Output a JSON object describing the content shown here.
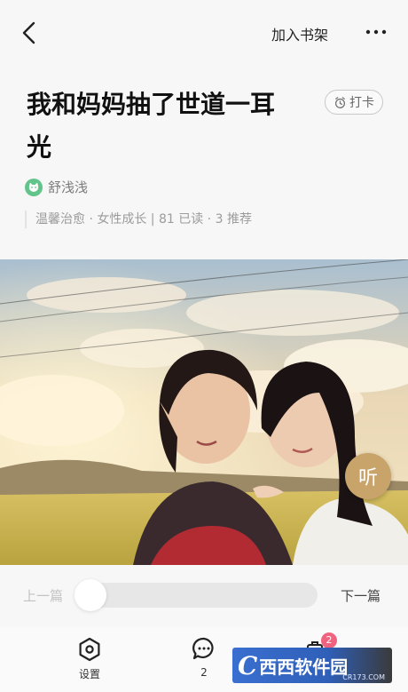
{
  "header": {
    "add_to_shelf": "加入书架"
  },
  "article": {
    "title": "我和妈妈抽了世道一耳光",
    "checkin_label": "打卡",
    "author": "舒浅浅",
    "meta": "温馨治愈 · 女性成长 | 81 已读 · 3 推荐"
  },
  "cover": {
    "listen_label": "听"
  },
  "navigation": {
    "prev_label": "上一篇",
    "next_label": "下一篇",
    "progress": 0.0
  },
  "bottom_bar": {
    "settings_label": "设置",
    "comment_count": "2",
    "shelf_badge": "2"
  },
  "watermark": {
    "text": "西西软件园",
    "url": "CR173.COM"
  },
  "colors": {
    "background": "#f7f7f7",
    "listen_button": "#c9a46a",
    "badge": "#f0627e",
    "author_avatar": "#62c48a"
  }
}
